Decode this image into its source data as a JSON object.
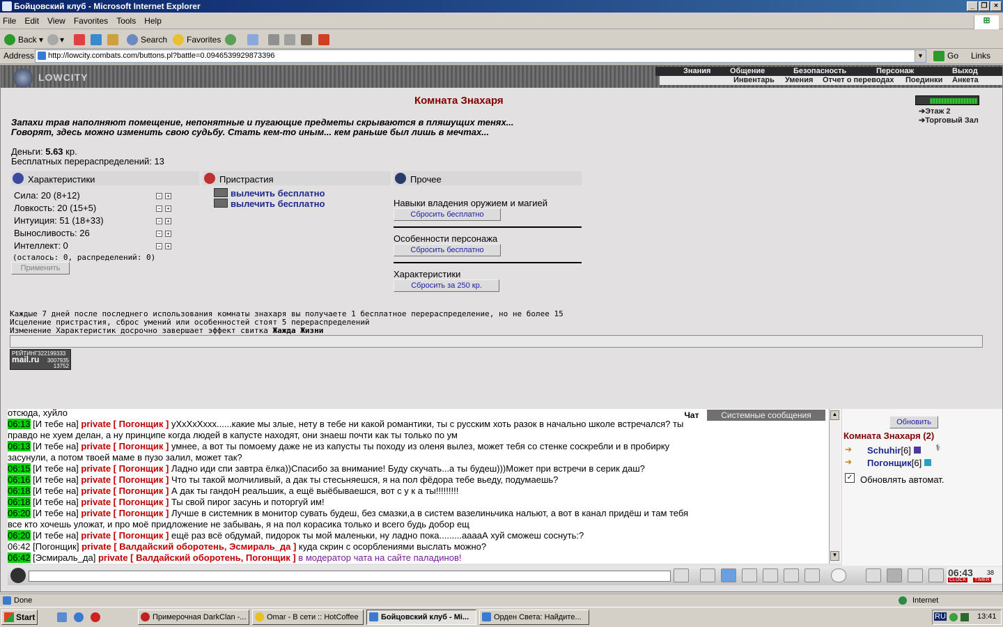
{
  "window": {
    "title": "Бойцовский клуб - Microsoft Internet Explorer"
  },
  "menu": [
    "File",
    "Edit",
    "View",
    "Favorites",
    "Tools",
    "Help"
  ],
  "toolbar": {
    "back": "Back",
    "search": "Search",
    "favorites": "Favorites"
  },
  "address": {
    "label": "Address",
    "url": "http://lowcity.combats.com/buttons.pl?battle=0.0946539929873396",
    "go": "Go",
    "links": "Links"
  },
  "game": {
    "logo": "LOWCITY",
    "topnav": [
      "Знания",
      "Общение",
      "Безопасность",
      "Персонаж",
      "Выход"
    ],
    "subnav": [
      "Инвентарь",
      "Умения",
      "Отчет о переводах",
      "Поединки",
      "Анкета"
    ],
    "room_title": "Комната Знахаря",
    "map_links": [
      "Этаж 2",
      "Торговый Зал"
    ],
    "desc1": "Запахи трав наполняют помещение, непонятные и пугающие предметы скрываются в пляшущих тенях...",
    "desc2": "Говорят, здесь можно изменить свою судьбу. Стать кем-то иным... кем раньше был лишь в мечтах...",
    "money_label": "Деньги:",
    "money_value": "5.63",
    "money_unit": "кр.",
    "free_redist": "Бесплатных перераспределений: 13",
    "stats_header": "Характеристики",
    "stats": [
      "Сила: 20 (8+12)",
      "Ловкость: 20 (15+5)",
      "Интуиция: 51 (18+33)",
      "Выносливость: 26",
      "Интеллект: 0"
    ],
    "remaining": "(осталось: 0, распределений: 0)",
    "apply": "Применить",
    "addict_header": "Пристрастия",
    "addict_items": [
      "вылечить бесплатно",
      "вылечить бесплатно"
    ],
    "other_header": "Прочее",
    "other_sections": [
      {
        "label": "Навыки владения оружием и магией",
        "button": "Сбросить бесплатно"
      },
      {
        "label": "Особенности персонажа",
        "button": "Сбросить бесплатно"
      },
      {
        "label": "Характеристики",
        "button": "Сбросить за 250 кр."
      }
    ],
    "note1": "Каждые 7 дней после последнего использования комнаты знахаря вы получаете 1 бесплатное перераспределение, но не более 15",
    "note2": "Исцеление пристрастия, сброс умений или особенностей стоят 5 перераспределений",
    "note3_prefix": "Изменение Характеристик досрочно завершает эффект свитка ",
    "note3_bold": "Жажда Жизни",
    "counter": {
      "title": "РЕЙТИНГ",
      "n1": "322199333",
      "brand": "mail.ru",
      "n2": "3007935",
      "n3": "13752"
    }
  },
  "chat": {
    "tab_chat": "Чат",
    "tab_system": "Системные сообщения",
    "lines": [
      {
        "plain": "отсюда, хуйло"
      },
      {
        "time": "06:13",
        "from": "[И тебе на]",
        "to": "private [ Погонщик ]",
        "text": "уXxXxXxxx......какие мы злые, нету в тебе ни какой романтики, ты с русским хоть разок в начально школе встречался? ты"
      },
      {
        "plain": "правдо не хуем делан, а ну принципе когда людей в капусте находят, они знаеш почти как ты только по ум"
      },
      {
        "time": "06:13",
        "from": "[И тебе на]",
        "to": "private [ Погонщик ]",
        "text": "умнее, а вот ты помоему даже не из капусты ты походу из оленя вылез, может тебя со стенке соскребли и в пробирку"
      },
      {
        "plain": "засунули, а потом твоей маме в пузо залил, может так?"
      },
      {
        "time": "06:15",
        "from": "[И тебе на]",
        "to": "private [ Погонщик ]",
        "text": "Ладно иди спи завтра ёлка))Спасибо за внимание! Буду скучать...а ты будеш)))Может при встречи в серик даш?"
      },
      {
        "time": "06:16",
        "from": "[И тебе на]",
        "to": "private [ Погонщик ]",
        "text": "Что ты такой молчиливый, а дак ты стесьняешся, я на пол фёдора тебе вьеду, подумаешь?"
      },
      {
        "time": "06:18",
        "from": "[И тебе на]",
        "to": "private [ Погонщик ]",
        "text": "А дак ты гандоН реальшик, а ещё выёбываешся, вот с у к а ты!!!!!!!!!"
      },
      {
        "time": "06:18",
        "from": "[И тебе на]",
        "to": "private [ Погонщик ]",
        "text": "Ты свой пирог засунь и поторгуй им!"
      },
      {
        "time": "06:20",
        "from": "[И тебе на]",
        "to": "private [ Погонщик ]",
        "text": "Лучше в системник в монитор сувать будеш, без смазки,а в систем вазелиньчика нальют, а вот в канал придёш и там тебя"
      },
      {
        "plain": "все кто хочешь уложат, и про моё придложение не забывањ, я на пол корасика только и всего будь добор ещ"
      },
      {
        "time": "06:20",
        "from": "[И тебе на]",
        "to": "private [ Погонщик ]",
        "text": "ещё раз всё обдумай, пидорок ты мой маленьки, ну ладно пока.........ааааА хуй сможеш соснуть:?"
      },
      {
        "time": "06:42",
        "from": "[Погонщик]",
        "to": "private [ Валдайский оборотень, Эсмираль_да ]",
        "text": "куда скрин с осорблениями выслать можно?"
      },
      {
        "time": "06:42",
        "from": "[Эсмираль_да]",
        "to": "private [ Валдайский оборотень, Погонщик ]",
        "text": "в модератор чата на сайте паладинов!"
      }
    ]
  },
  "side": {
    "refresh": "Обновить",
    "room": "Комната Знахаря (2)",
    "users": [
      {
        "name": "Schuhir",
        "level": "[6]"
      },
      {
        "name": "Погонщик",
        "level": "[6]"
      }
    ],
    "auto": "Обновлять автомат."
  },
  "clock": {
    "time": "06:43",
    "sec": "38",
    "l1": "CLOCK",
    "l2": "TIMER"
  },
  "status": {
    "done": "Done",
    "zone": "Internet"
  },
  "taskbar": {
    "start": "Start",
    "tasks": [
      "Примерочная DarkClan -...",
      "Omar - В сети :: HotCoffee",
      "Бойцовский клуб - Mi...",
      "Орден Света: Найдите..."
    ],
    "lang": "RU",
    "time": "13:41"
  }
}
